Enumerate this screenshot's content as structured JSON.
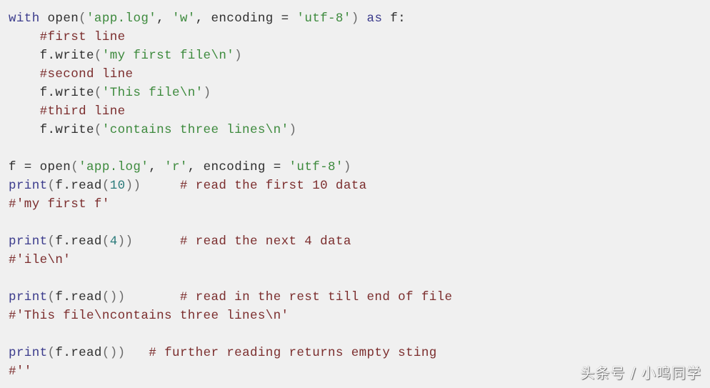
{
  "lines": [
    [
      {
        "t": "with",
        "c": "kw"
      },
      {
        "t": " open",
        "c": "plain"
      },
      {
        "t": "(",
        "c": "paren"
      },
      {
        "t": "'app.log'",
        "c": "str"
      },
      {
        "t": ", ",
        "c": "plain"
      },
      {
        "t": "'w'",
        "c": "str"
      },
      {
        "t": ", encoding = ",
        "c": "plain"
      },
      {
        "t": "'utf-8'",
        "c": "str"
      },
      {
        "t": ")",
        "c": "paren"
      },
      {
        "t": " ",
        "c": "plain"
      },
      {
        "t": "as",
        "c": "kw"
      },
      {
        "t": " f:",
        "c": "plain"
      }
    ],
    [
      {
        "t": "    #first line",
        "c": "com"
      }
    ],
    [
      {
        "t": "    f.write",
        "c": "plain"
      },
      {
        "t": "(",
        "c": "paren"
      },
      {
        "t": "'my first file\\n'",
        "c": "str"
      },
      {
        "t": ")",
        "c": "paren"
      }
    ],
    [
      {
        "t": "    #second line",
        "c": "com"
      }
    ],
    [
      {
        "t": "    f.write",
        "c": "plain"
      },
      {
        "t": "(",
        "c": "paren"
      },
      {
        "t": "'This file\\n'",
        "c": "str"
      },
      {
        "t": ")",
        "c": "paren"
      }
    ],
    [
      {
        "t": "    #third line",
        "c": "com"
      }
    ],
    [
      {
        "t": "    f.write",
        "c": "plain"
      },
      {
        "t": "(",
        "c": "paren"
      },
      {
        "t": "'contains three lines\\n'",
        "c": "str"
      },
      {
        "t": ")",
        "c": "paren"
      }
    ],
    [],
    [
      {
        "t": "f = open",
        "c": "plain"
      },
      {
        "t": "(",
        "c": "paren"
      },
      {
        "t": "'app.log'",
        "c": "str"
      },
      {
        "t": ", ",
        "c": "plain"
      },
      {
        "t": "'r'",
        "c": "str"
      },
      {
        "t": ", encoding = ",
        "c": "plain"
      },
      {
        "t": "'utf-8'",
        "c": "str"
      },
      {
        "t": ")",
        "c": "paren"
      }
    ],
    [
      {
        "t": "print",
        "c": "kw"
      },
      {
        "t": "(",
        "c": "paren"
      },
      {
        "t": "f.read",
        "c": "plain"
      },
      {
        "t": "(",
        "c": "paren"
      },
      {
        "t": "10",
        "c": "num"
      },
      {
        "t": "))",
        "c": "paren"
      },
      {
        "t": "     # read the first 10 data",
        "c": "com"
      }
    ],
    [
      {
        "t": "#'my first f'",
        "c": "com"
      }
    ],
    [],
    [
      {
        "t": "print",
        "c": "kw"
      },
      {
        "t": "(",
        "c": "paren"
      },
      {
        "t": "f.read",
        "c": "plain"
      },
      {
        "t": "(",
        "c": "paren"
      },
      {
        "t": "4",
        "c": "num"
      },
      {
        "t": "))",
        "c": "paren"
      },
      {
        "t": "      # read the next 4 data",
        "c": "com"
      }
    ],
    [
      {
        "t": "#'ile\\n'",
        "c": "com"
      }
    ],
    [],
    [
      {
        "t": "print",
        "c": "kw"
      },
      {
        "t": "(",
        "c": "paren"
      },
      {
        "t": "f.read",
        "c": "plain"
      },
      {
        "t": "())",
        "c": "paren"
      },
      {
        "t": "       # read in the rest till end of file",
        "c": "com"
      }
    ],
    [
      {
        "t": "#'This file\\ncontains three lines\\n'",
        "c": "com"
      }
    ],
    [],
    [
      {
        "t": "print",
        "c": "kw"
      },
      {
        "t": "(",
        "c": "paren"
      },
      {
        "t": "f.read",
        "c": "plain"
      },
      {
        "t": "())",
        "c": "paren"
      },
      {
        "t": "   # further reading returns empty sting",
        "c": "com"
      }
    ],
    [
      {
        "t": "#''",
        "c": "com"
      }
    ]
  ],
  "watermark": "头条号 / 小鸣同学"
}
